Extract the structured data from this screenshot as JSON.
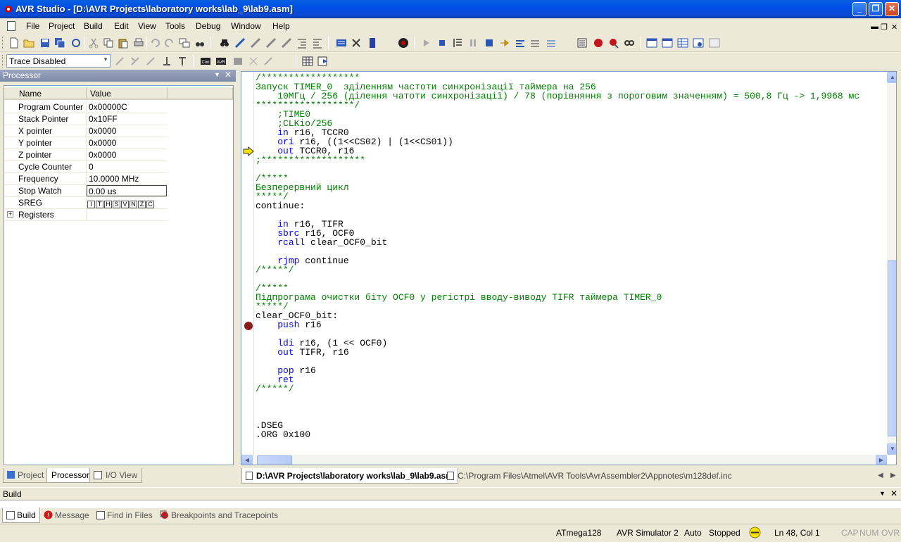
{
  "window": {
    "title": "AVR Studio - [D:\\AVR Projects\\laboratory works\\lab_9\\lab9.asm]"
  },
  "menu": [
    "File",
    "Project",
    "Build",
    "Edit",
    "View",
    "Tools",
    "Debug",
    "Window",
    "Help"
  ],
  "trace": {
    "value": "Trace Disabled"
  },
  "processor_panel": {
    "title": "Processor",
    "columns": [
      "Name",
      "Value"
    ],
    "rows": [
      {
        "name": "Program Counter",
        "value": "0x00000C"
      },
      {
        "name": "Stack Pointer",
        "value": "0x10FF"
      },
      {
        "name": "X pointer",
        "value": "0x0000"
      },
      {
        "name": "Y pointer",
        "value": "0x0000"
      },
      {
        "name": "Z pointer",
        "value": "0x0000"
      },
      {
        "name": "Cycle Counter",
        "value": "0"
      },
      {
        "name": "Frequency",
        "value": "10.0000 MHz"
      },
      {
        "name": "Stop Watch",
        "value": "0.00 us"
      },
      {
        "name": "SREG",
        "value": ""
      },
      {
        "name": "Registers",
        "value": ""
      }
    ],
    "sreg_flags": [
      "I",
      "T",
      "H",
      "S",
      "V",
      "N",
      "Z",
      "C"
    ]
  },
  "left_tabs": [
    "Project",
    "Processor",
    "I/O View"
  ],
  "editor": {
    "lines": [
      "/******************",
      "Запуск TIMER_0  зділенням частоти синхронізації таймера на 256",
      "    10МГц / 256 (ділення чатоти синхронізації) / 78 (порівняння з пороговим значенням) = 500,8 Гц -> 1,9968 мс",
      "******************/",
      "    ;TIME0",
      "    ;CLKio/256",
      "    in r16, TCCR0",
      "    ori r16, ((1<<CS02) | (1<<CS01))",
      "    out TCCR0, r16",
      ";*******************",
      "",
      "/*****",
      "Безперервний цикл",
      "*****/",
      "continue:",
      "",
      "    in r16, TIFR",
      "    sbrc r16, OCF0",
      "    rcall clear_OCF0_bit",
      "",
      "    rjmp continue",
      "/*****/",
      "",
      "/*****",
      "Підпрограма очистки біту OCF0 у регістрі вводу-виводу TIFR таймера TIMER_0",
      "*****/",
      "clear_OCF0_bit:",
      "    push r16",
      "",
      "    ldi r16, (1 << OCF0)",
      "    out TIFR, r16",
      "",
      "    pop r16",
      "    ret",
      "/*****/",
      "",
      "",
      "",
      ".DSEG",
      ".ORG 0x100"
    ]
  },
  "doc_tabs": [
    "D:\\AVR Projects\\laboratory works\\lab_9\\lab9.asm",
    "C:\\Program Files\\Atmel\\AVR Tools\\AvrAssembler2\\Appnotes\\m128def.inc"
  ],
  "build_panel": {
    "title": "Build"
  },
  "build_tabs": [
    "Build",
    "Message",
    "Find in Files",
    "Breakpoints and Tracepoints"
  ],
  "status": {
    "device": "ATmega128",
    "platform": "AVR Simulator 2",
    "mode": "Auto",
    "state": "Stopped",
    "position": "Ln 48, Col 1",
    "caps": "CAP",
    "num": "NUM",
    "ovr": "OVR"
  },
  "colors": {
    "comment": "#008000",
    "keyword": "#0000ff",
    "breakpoint": "#8b1a1a",
    "arrow": "#f5e400"
  }
}
